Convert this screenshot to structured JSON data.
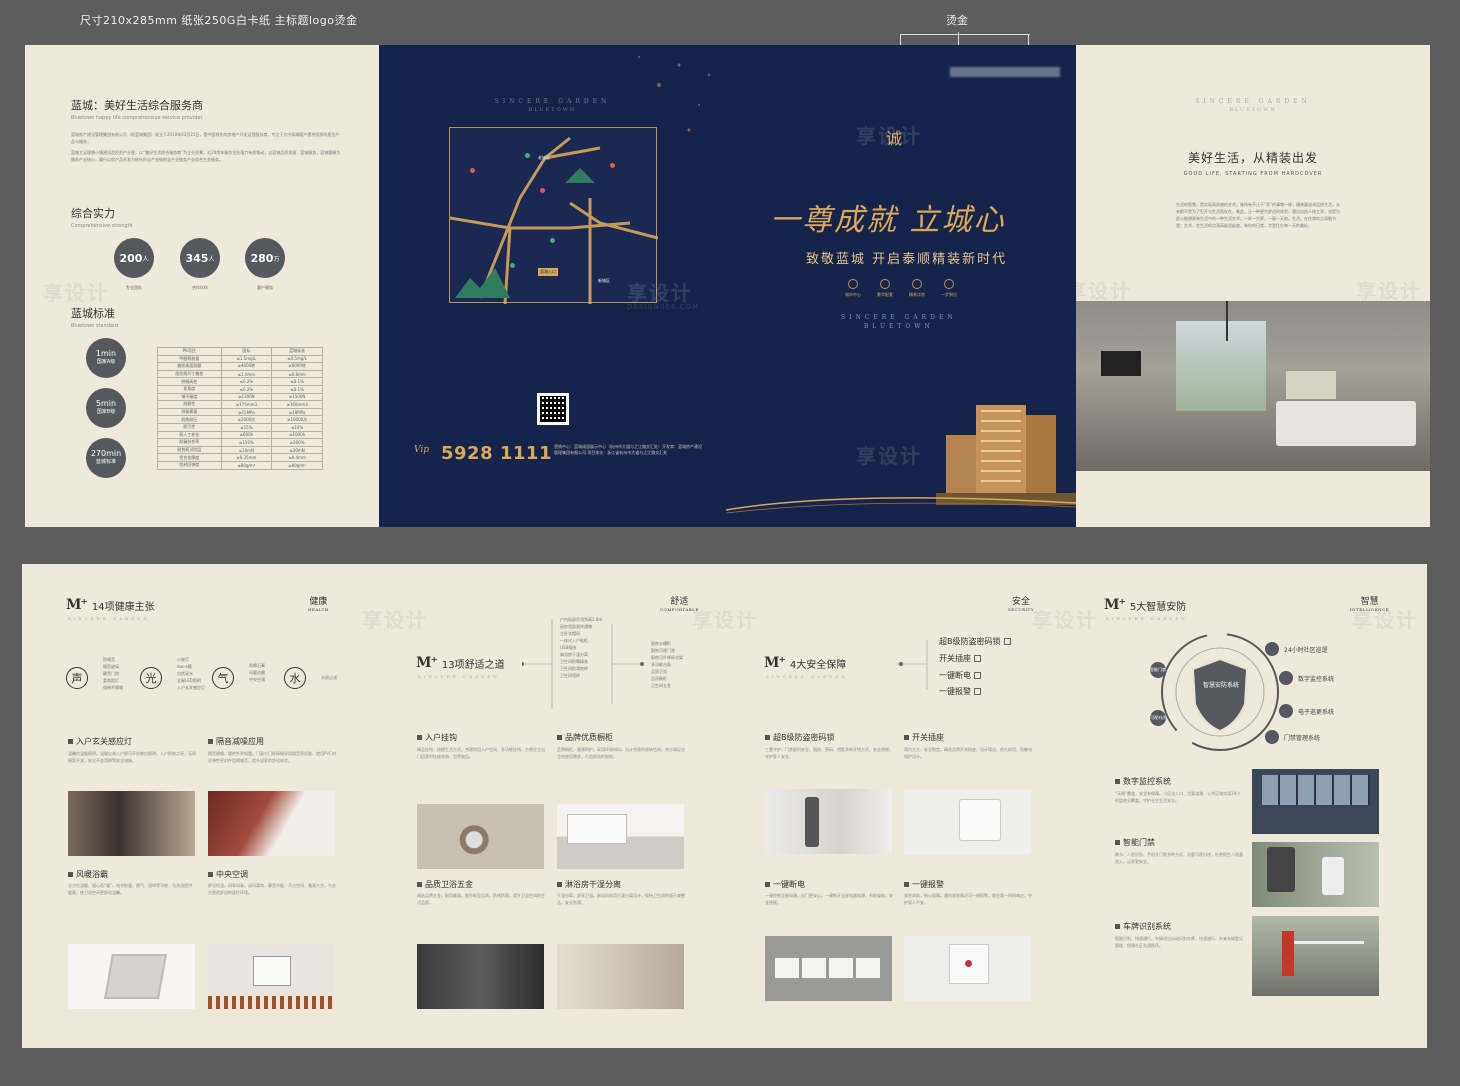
{
  "annotations": {
    "spec": "尺寸210x285mm   纸张250G白卡纸   主标题logo烫金",
    "foil": "烫金"
  },
  "panel1": {
    "title": "蓝城：美好生活综合服务商",
    "subtitle": "Bluetown happy life comprehensive service provider",
    "paragraphs": [
      "蓝城房产建设管理集团有限公司（前蓝城集团）成立于2010年03月25日，是中国领先的房地产开发运营服务商，专注于为中高端客户提供优质的居住产品与服务。",
      "蓝城立足理想小镇建设及投资产业营，以“美好生活综合服务商”为企业愿景，近20余年服务全业强力有质推动，以蓝城品质发展，蓝城服务，蓝城健康为服务产业核心，履行以房产品开发为依托的全产业链的全产业链务产业综合生态服务。"
    ],
    "strength_title": "综合实力",
    "strength_sub": "Comprehensive strength",
    "stats": [
      {
        "value": "200",
        "unit": "人",
        "caption": "专业团队"
      },
      {
        "value": "345",
        "unit": "人",
        "caption": "合作伙伴"
      },
      {
        "value": "280",
        "unit": "万",
        "caption": "客户服务"
      }
    ],
    "standard_title": "蓝城标准",
    "standard_sub": "Bluetown standard",
    "standard_circles": [
      {
        "value": "1min",
        "label": "国家A级"
      },
      {
        "value": "5min",
        "label": "国家B级"
      },
      {
        "value": "270min",
        "label": "蓝城标准"
      }
    ],
    "table_headers": [
      "PK项目",
      "国标",
      "蓝城标准"
    ],
    "table_rows": [
      [
        "甲醛释放量",
        "≤1.5mg/L",
        "≤0.5mg/L"
      ],
      [
        "抽检表面耐磨",
        "≥4000转",
        "≥6000转"
      ],
      [
        "组拉线尺寸偏差",
        "≤1.0mm",
        "≤0.8mm"
      ],
      [
        "拼缝高差",
        "≤0.2%",
        "≤0.1%"
      ],
      [
        "直角度",
        "≤0.2%",
        "≤0.1%"
      ],
      [
        "铺平精度",
        "≥1300N",
        "≥1500N"
      ],
      [
        "耐磨性",
        "≥175mm3",
        "≥160mm3"
      ],
      [
        "拼板模量",
        "≥15MPa",
        "≥18MPa"
      ],
      [
        "耐热耐压",
        "≥2000次",
        "≥10000次"
      ],
      [
        "耐污性",
        "≤15%",
        "≤10%"
      ],
      [
        "耐人工老化",
        "≥600h",
        "≥1000h"
      ],
      [
        "耐漏份合率",
        "≥150%",
        "≥200%"
      ],
      [
        "耐划痕试验层",
        "≤10mN",
        "≤30mN"
      ],
      [
        "铝合金厚度",
        "≥0.35mm",
        "≥0.4mm"
      ],
      [
        "铝材回弹度",
        "≥80g/m²",
        "≥80g/m²"
      ]
    ]
  },
  "panel2": {
    "brand_en": "SINCERE GARDEN",
    "brand_sub": "BLUETOWN",
    "map_labels": [
      "老城区",
      "新城区",
      "滨海入口"
    ],
    "hotline": "5928 1111",
    "vip": "Vip",
    "address": "营销中心：蓝城诚园展示中心（杭州市大道与之江路交汇处）开发商：蓝城房产建设管理集团有限公司 项目地址：浙江省杭州市大道与之江路交汇处"
  },
  "panel3": {
    "slogan": "一尊成就 立城心",
    "subslogan": "致敬蓝城  开启泰顺精装新时代",
    "features": [
      "城市中心",
      "繁华配套",
      "精装洋房",
      "一步到位"
    ],
    "brand_en": "SINCERE GARDEN",
    "brand_sub": "BLUETOWN"
  },
  "panel4": {
    "brand_en": "SINCERE GARDEN",
    "brand_sub": "BLUETOWN",
    "heading": "美好生活，从精装出发",
    "heading_en": "GOOD LIFE, STARTING FROM HARDCOVER",
    "body": "生活的智慧，是实现高质感的艺术，像所有不止于“家”的事物一样，精装要追求品质生活，从来都不是为了犯开与生活而存在。唯此，让一种更为舒适的体验，遇见自由人体工学，也是为此心细想意装生活中的一种生活艺术。一轩一世界，一窗一天地。生活，在往常的点滴细节里；艺术，在生活的点滴高级里绽放。有你的日常，才是住在每一天的美好。"
  },
  "health": {
    "section_title": "14项健康主张",
    "cat_cn": "健康",
    "cat_en": "HEALTH",
    "glyphs": [
      "声",
      "光",
      "气",
      "水"
    ],
    "bullets": [
      [
        "防噪音",
        "隔音玻璃",
        "静音门锁",
        "柔和阻尼",
        "电梯井隔噪"
      ],
      [
        "小夜灯",
        "low-e膜",
        "自然采光",
        "全屋LED照明",
        "入户玄关感应灯"
      ],
      [
        "防霉石膏",
        "风暖浴霸",
        "中央空调"
      ],
      [
        "水质过滤"
      ]
    ],
    "features": [
      {
        "title": "入户玄关感应灯",
        "text": "温馨的温暖照明。温暖以来入户即可开启感应照明，入户即刻点亮，无须摸索开关，安全不会滑倒等安全措施。"
      },
      {
        "title": "隔音减噪应用",
        "text": "隔音隔噪，隔绝外界喧嚣。门窗与门框接缝采用隔音密封胶，使用PVC材质弹性密封件阻隔噪音，提升居家的舒适体验。"
      },
      {
        "title": "风暖浴霸",
        "text": "全方位温暖，随心而“暖”。结合取暖、换气、照明等功能，为洗浴提供暖意，使卫浴空间更舒适温馨。"
      },
      {
        "title": "中央空调",
        "text": "舒适恒温，四季如春。送风柔和，静音节能，不占空间，美观大方，为业主营造舒适的居住环境。"
      }
    ]
  },
  "comfort": {
    "section_title": "13项舒适之道",
    "cat_cn": "舒适",
    "cat_en": "COMFORTABLE",
    "left_bullets": [
      "户内局部吊顶净高2.8m",
      "厨房墙面瓷砖通铺",
      "主卧衣帽间",
      "一体化入户鞋柜",
      "USB插座",
      "淋浴房干湿分离",
      "卫生间防霉精装",
      "卫生间防滑地砖",
      "卫生间墙砖"
    ],
    "right_bullets": [
      "厨房水槽柜",
      "厨房可视门禁",
      "厨房可升降晾衣架",
      "多功能台面",
      "品质卫浴",
      "品质橱柜",
      "卫生间五金"
    ],
    "features": [
      {
        "title": "入户挂钩",
        "text": "精品挂钩，快捷生活方式。合理利用入户空间，多功能挂钩，方便业主出门回家时挂放衣物、包等物品。"
      },
      {
        "title": "品牌优质橱柜",
        "text": "品牌橱柜，健康呵护。采用环保材料，设计合理的收纳空间，充分满足业主的使用需求，打造舒适的厨房。"
      },
      {
        "title": "品质卫浴五金",
        "text": "精选品牌五金，耐用美观，细节彰显品质，防锈防腐，提升卫浴空间的生活品质。"
      },
      {
        "title": "淋浴房干湿分离",
        "text": "干湿分离，舒享卫浴。淋浴间采用干湿分离设计，保持卫生间地面干爽整洁，安全防滑。"
      }
    ]
  },
  "safety": {
    "section_title": "4大安全保障",
    "cat_cn": "安全",
    "cat_en": "SECURITY",
    "items": [
      "超B级防盗密码锁",
      "开关插座",
      "一键断电",
      "一键报警"
    ],
    "features": [
      {
        "title": "超B级防盗密码锁",
        "text": "三重守护，门禁级别安全。指纹、密码、钥匙多种开锁方式，安全便捷，守护家人安全。"
      },
      {
        "title": "开关插座",
        "text": "简约大方，安全稳定。精选品牌开关插座，设计简洁，经久耐用，防触电保护设计。"
      },
      {
        "title": "一键断电",
        "text": "一键控制全屋电源，出门更安心。一键断开全屋电器电源，节能省电，安全便捷。"
      },
      {
        "title": "一键报警",
        "text": "紧急求助，贴心保障。遇到紧急情况可一键报警，物业第一时间响应，守护家人平安。"
      }
    ]
  },
  "smart": {
    "section_title": "5大智慧安防",
    "cat_cn": "智慧",
    "cat_en": "INTELLIGENCE",
    "shield": "智慧安防系统",
    "ring_labels": [
      "智能门禁",
      "可视对讲"
    ],
    "items": [
      "24小时社区巡逻",
      "数字监控系统",
      "电子巡更系统",
      "门禁管理系统"
    ],
    "features": [
      {
        "title": "数字监控系统",
        "text": "“天眼”覆盖，安全有保障。小区出入口、主要道路、公共区域实现24小时监控全覆盖，守护业主生活安全。"
      },
      {
        "title": "智能门禁",
        "text": "刷卡、人脸识别、手机开门等多种方式，访客可视对讲，杜绝陌生人随意进入，让家更安全。"
      },
      {
        "title": "车牌识别系统",
        "text": "智能识别，快速通行。车辆进出自动识别车牌，快速放行，外来车辆登记管理，保障社区交通秩序。"
      }
    ]
  },
  "colors": {
    "navy": "#16234a",
    "gold": "#d9a85a",
    "beige": "#efe9dc",
    "circle": "#55585f"
  }
}
